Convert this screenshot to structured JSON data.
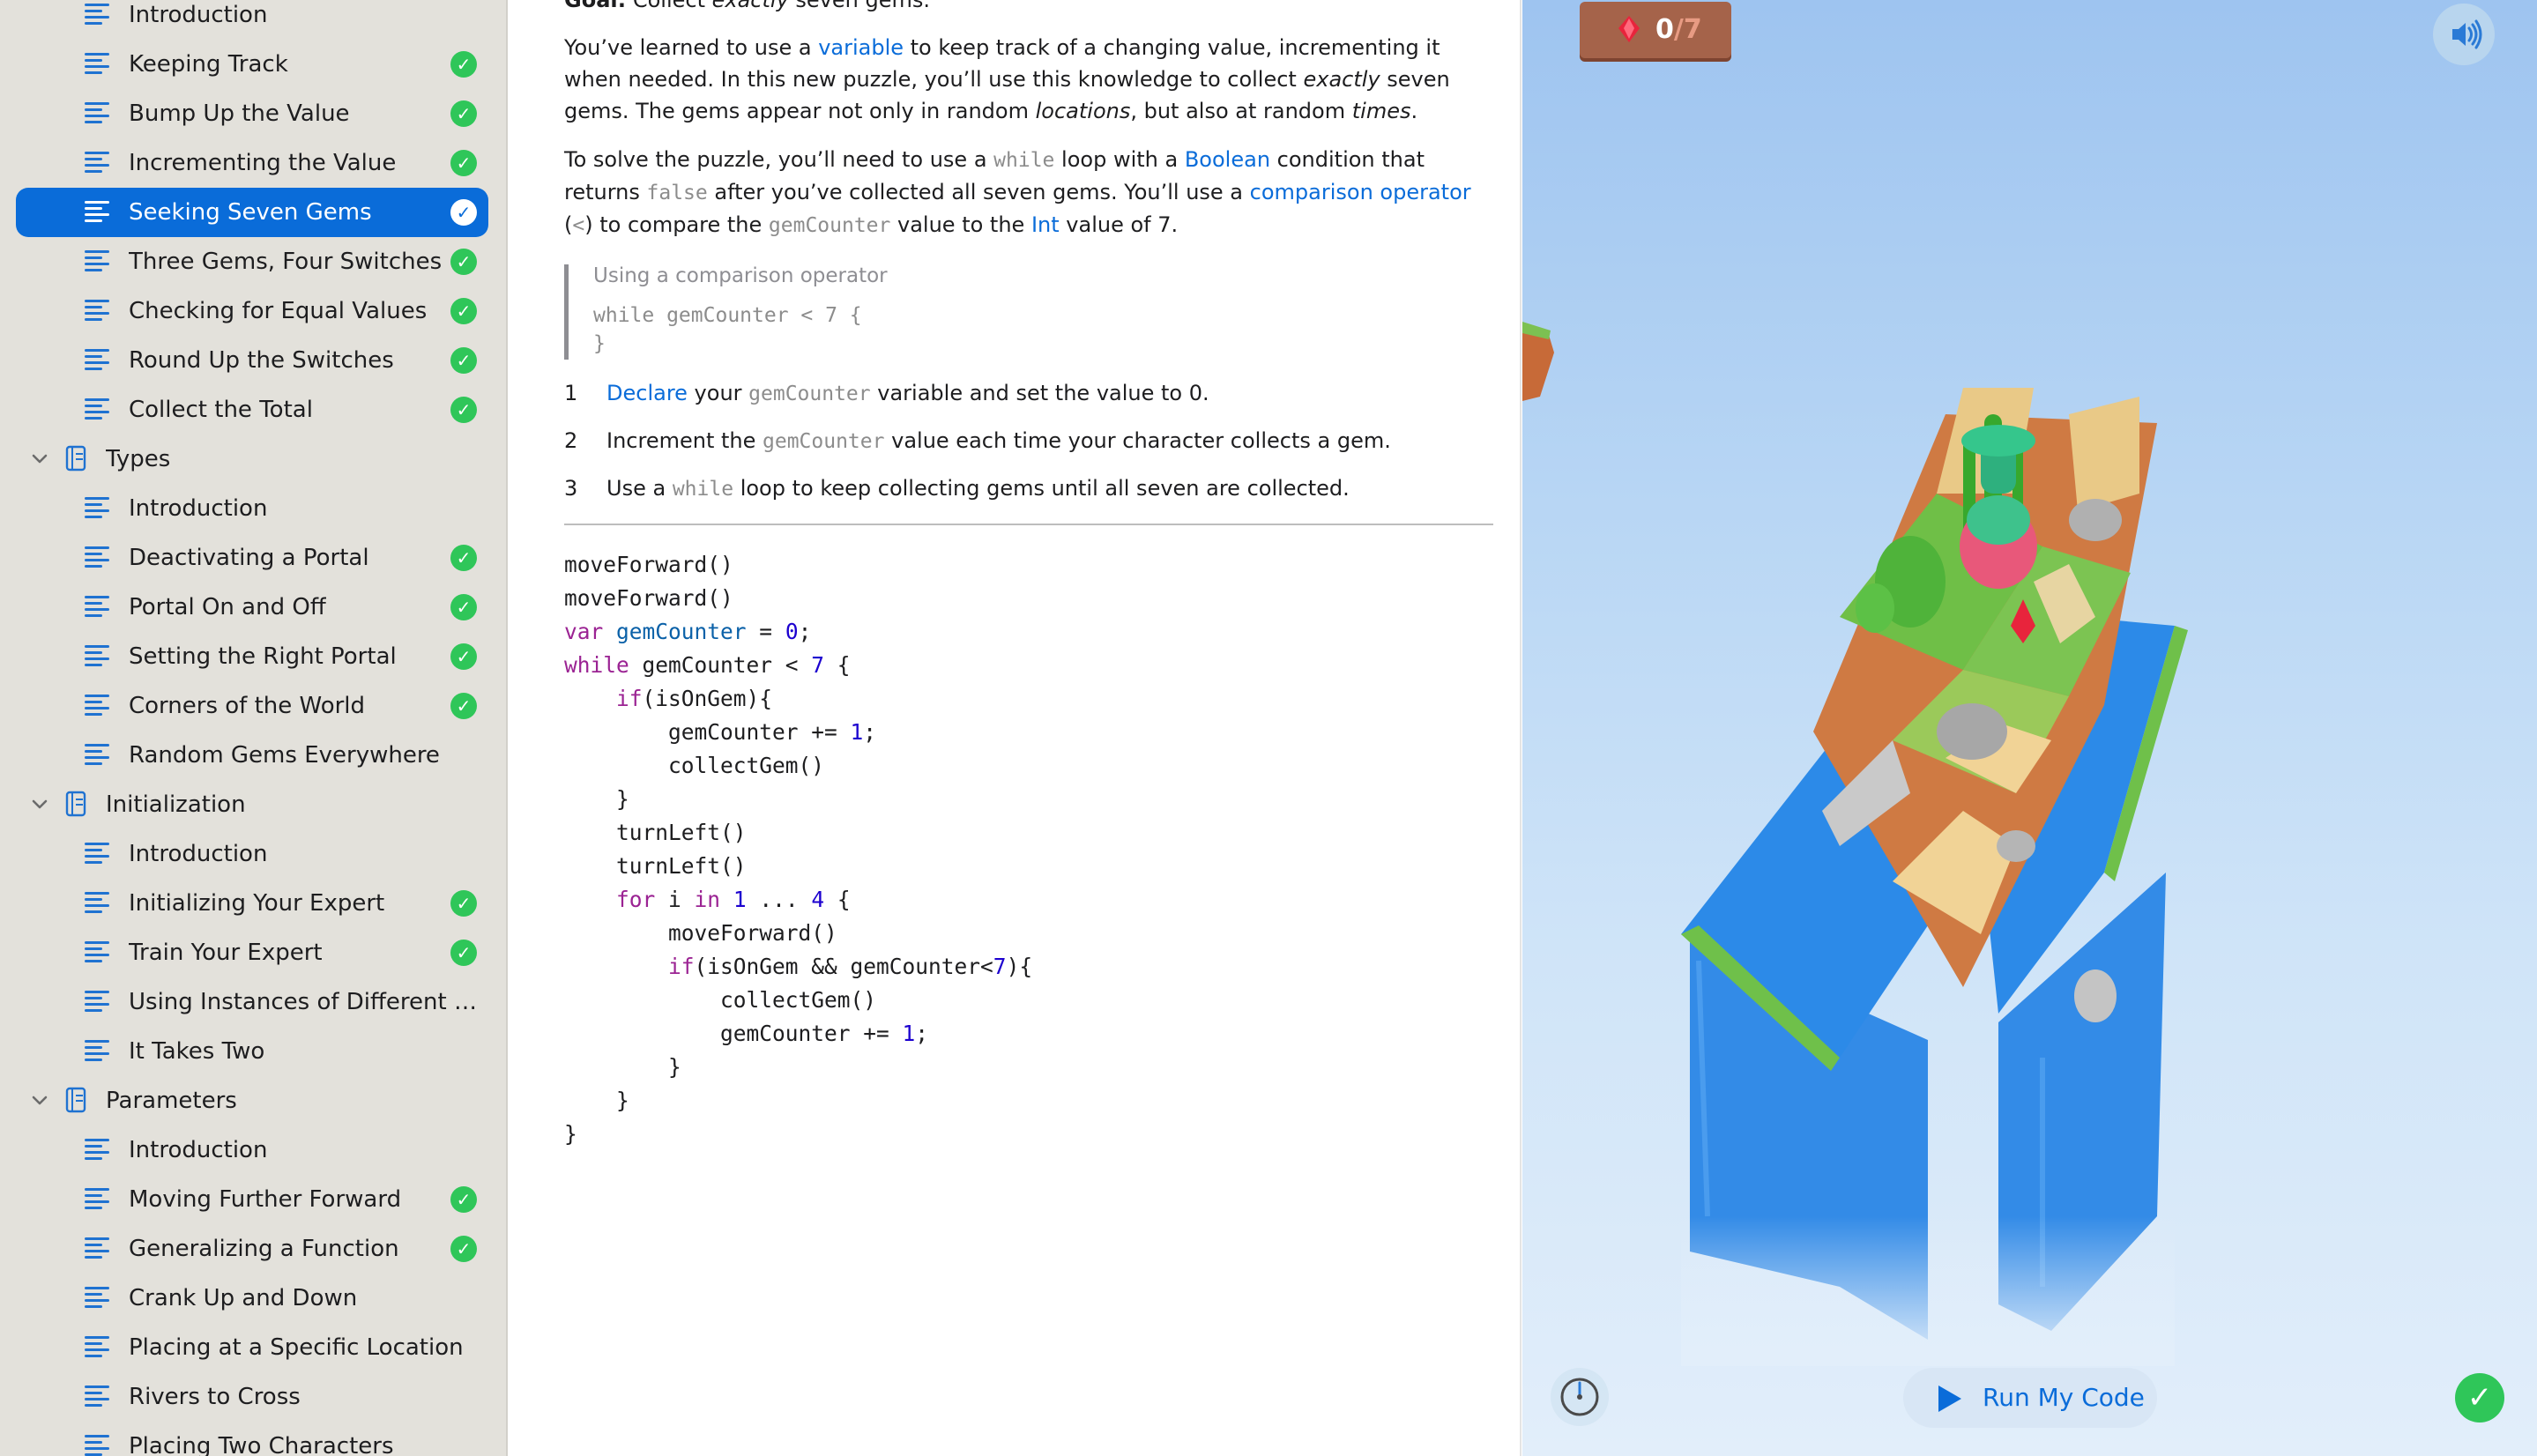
{
  "sidebar": {
    "rows": [
      {
        "label": "Introduction",
        "kind": "page",
        "done": false
      },
      {
        "label": "Keeping Track",
        "kind": "page",
        "done": true
      },
      {
        "label": "Bump Up the Value",
        "kind": "page",
        "done": true
      },
      {
        "label": "Incrementing the Value",
        "kind": "page",
        "done": true
      },
      {
        "label": "Seeking Seven Gems",
        "kind": "page",
        "done": true,
        "selected": true
      },
      {
        "label": "Three Gems, Four Switches",
        "kind": "page",
        "done": true
      },
      {
        "label": "Checking for Equal Values",
        "kind": "page",
        "done": true
      },
      {
        "label": "Round Up the Switches",
        "kind": "page",
        "done": true
      },
      {
        "label": "Collect the Total",
        "kind": "page",
        "done": true
      },
      {
        "label": "Types",
        "kind": "section"
      },
      {
        "label": "Introduction",
        "kind": "page",
        "done": false
      },
      {
        "label": "Deactivating a Portal",
        "kind": "page",
        "done": true
      },
      {
        "label": "Portal On and Off",
        "kind": "page",
        "done": true
      },
      {
        "label": "Setting the Right Portal",
        "kind": "page",
        "done": true
      },
      {
        "label": "Corners of the World",
        "kind": "page",
        "done": true
      },
      {
        "label": "Random Gems Everywhere",
        "kind": "page",
        "done": false
      },
      {
        "label": "Initialization",
        "kind": "section"
      },
      {
        "label": "Introduction",
        "kind": "page",
        "done": false
      },
      {
        "label": "Initializing Your Expert",
        "kind": "page",
        "done": true
      },
      {
        "label": "Train Your Expert",
        "kind": "page",
        "done": true
      },
      {
        "label": "Using Instances of Different Ty...",
        "kind": "page",
        "done": false
      },
      {
        "label": "It Takes Two",
        "kind": "page",
        "done": false
      },
      {
        "label": "Parameters",
        "kind": "section"
      },
      {
        "label": "Introduction",
        "kind": "page",
        "done": false
      },
      {
        "label": "Moving Further Forward",
        "kind": "page",
        "done": true
      },
      {
        "label": "Generalizing a Function",
        "kind": "page",
        "done": true
      },
      {
        "label": "Crank Up and Down",
        "kind": "page",
        "done": false
      },
      {
        "label": "Placing at a Specific Location",
        "kind": "page",
        "done": false
      },
      {
        "label": "Rivers to Cross",
        "kind": "page",
        "done": false
      },
      {
        "label": "Placing Two Characters",
        "kind": "page",
        "done": false
      }
    ]
  },
  "content": {
    "goal": {
      "label": "Goal:",
      "t1": " Collect ",
      "em": "exactly",
      "t2": " seven gems."
    },
    "para1": {
      "t1": "You’ve learned to use a ",
      "link1": "variable",
      "t2": " to keep track of a changing value, incrementing it when needed. In this new puzzle, you’ll use this knowledge to collect ",
      "em1": "exactly",
      "t3": " seven gems. The gems appear not only in random ",
      "em2": "locations",
      "t4": ", but also at random ",
      "em3": "times",
      "t5": "."
    },
    "para2": {
      "t1": "To solve the puzzle, you’ll need to use a ",
      "c1": "while",
      "t2": " loop with a ",
      "link1": "Boolean",
      "t3": " condition that returns ",
      "c2": "false",
      "t4": " after you’ve collected all seven gems. You’ll use a ",
      "link2": "comparison operator",
      "t5": " (",
      "c3": "<",
      "t6": ") to compare the ",
      "c4": "gemCounter",
      "t7": " value to the ",
      "link3": "Int",
      "t8": " value of 7."
    },
    "snippet": {
      "caption": "Using a comparison operator",
      "line1": "while gemCounter < 7 {",
      "line2": "}"
    },
    "steps": [
      {
        "num": "1",
        "link": "Declare",
        "t1": " your ",
        "code": "gemCounter",
        "t2": " variable and set the value to 0."
      },
      {
        "num": "2",
        "link": "",
        "t1": "Increment the ",
        "code": "gemCounter",
        "t2": " value each time your character collects a gem."
      },
      {
        "num": "3",
        "link": "",
        "t1": "Use a ",
        "code": "while",
        "t2": " loop to keep collecting gems until all seven are collected."
      }
    ],
    "code_lines": [
      [
        [
          "",
          "moveForward()"
        ]
      ],
      [
        [
          "",
          "moveForward()"
        ]
      ],
      [
        [
          "kw",
          "var"
        ],
        [
          "",
          " "
        ],
        [
          "tp",
          "gemCounter"
        ],
        [
          "",
          " = "
        ],
        [
          "nm",
          "0"
        ],
        [
          "",
          ";"
        ]
      ],
      [
        [
          "kw",
          "while"
        ],
        [
          "",
          " gemCounter < "
        ],
        [
          "nm",
          "7"
        ],
        [
          "",
          " {"
        ]
      ],
      [
        [
          "",
          "    "
        ],
        [
          "kw",
          "if"
        ],
        [
          "",
          "(isOnGem){"
        ]
      ],
      [
        [
          "",
          "        gemCounter += "
        ],
        [
          "nm",
          "1"
        ],
        [
          "",
          ";"
        ]
      ],
      [
        [
          "",
          "        collectGem()"
        ]
      ],
      [
        [
          "",
          "    }"
        ]
      ],
      [
        [
          "",
          "    turnLeft()"
        ]
      ],
      [
        [
          "",
          "    turnLeft()"
        ]
      ],
      [
        [
          "",
          "    "
        ],
        [
          "kw",
          "for"
        ],
        [
          "",
          " i "
        ],
        [
          "kw",
          "in"
        ],
        [
          "",
          " "
        ],
        [
          "nm",
          "1"
        ],
        [
          "",
          " ... "
        ],
        [
          "nm",
          "4"
        ],
        [
          "",
          " {"
        ]
      ],
      [
        [
          "",
          "        moveForward()"
        ]
      ],
      [
        [
          "",
          "        "
        ],
        [
          "kw",
          "if"
        ],
        [
          "",
          "(isOnGem && gemCounter<"
        ],
        [
          "nm",
          "7"
        ],
        [
          "",
          "){"
        ]
      ],
      [
        [
          "",
          "            collectGem()"
        ]
      ],
      [
        [
          "",
          "            gemCounter += "
        ],
        [
          "nm",
          "1"
        ],
        [
          "",
          ";"
        ]
      ],
      [
        [
          "",
          "        }"
        ]
      ],
      [
        [
          "",
          "    }"
        ]
      ],
      [
        [
          "",
          "}"
        ]
      ]
    ]
  },
  "liveview": {
    "gem_count": "0",
    "gem_total": "/7",
    "run_label": "Run My Code",
    "icons": {
      "sound": "speaker-icon",
      "speed": "speedometer-icon",
      "done": "checkmark-icon",
      "run": "play-icon",
      "gem": "gem-icon"
    },
    "colors": {
      "accent": "#0a6cd9",
      "success": "#2fc659",
      "water": "#2a86e6",
      "grass": "#6fc04a"
    }
  }
}
